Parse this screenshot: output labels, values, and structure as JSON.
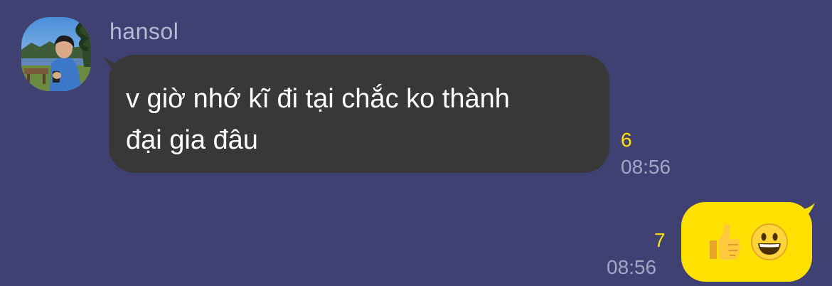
{
  "conversation": {
    "incoming": {
      "sender_name": "hansol",
      "avatar_icon": "profile-photo",
      "text": "v giờ nhớ kĩ đi tại chắc ko thành\nđại gia đâu",
      "unread_count": "6",
      "time": "08:56",
      "bubble_color": "#383838"
    },
    "outgoing": {
      "emojis": [
        "thumbs-up-icon",
        "grinning-face-icon"
      ],
      "unread_count": "7",
      "time": "08:56",
      "bubble_color": "#ffe100"
    }
  },
  "colors": {
    "background": "#3f4173",
    "unread_badge": "#ffe100",
    "timestamp": "#a3a6c6",
    "sender_name": "#b8b9d4"
  }
}
